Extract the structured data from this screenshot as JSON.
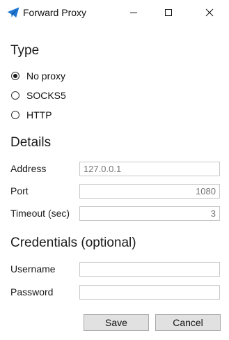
{
  "window": {
    "title": "Forward Proxy",
    "icon": "paper-plane-icon",
    "accent_color": "#1e78d2"
  },
  "type_section": {
    "heading": "Type",
    "options": [
      {
        "label": "No proxy",
        "selected": true
      },
      {
        "label": "SOCKS5",
        "selected": false
      },
      {
        "label": "HTTP",
        "selected": false
      }
    ]
  },
  "details_section": {
    "heading": "Details",
    "address": {
      "label": "Address",
      "placeholder": "127.0.0.1",
      "value": ""
    },
    "port": {
      "label": "Port",
      "placeholder": "1080",
      "value": ""
    },
    "timeout": {
      "label": "Timeout (sec)",
      "placeholder": "3",
      "value": ""
    }
  },
  "credentials_section": {
    "heading": "Credentials (optional)",
    "username": {
      "label": "Username",
      "value": ""
    },
    "password": {
      "label": "Password",
      "value": ""
    }
  },
  "buttons": {
    "save": "Save",
    "cancel": "Cancel"
  }
}
